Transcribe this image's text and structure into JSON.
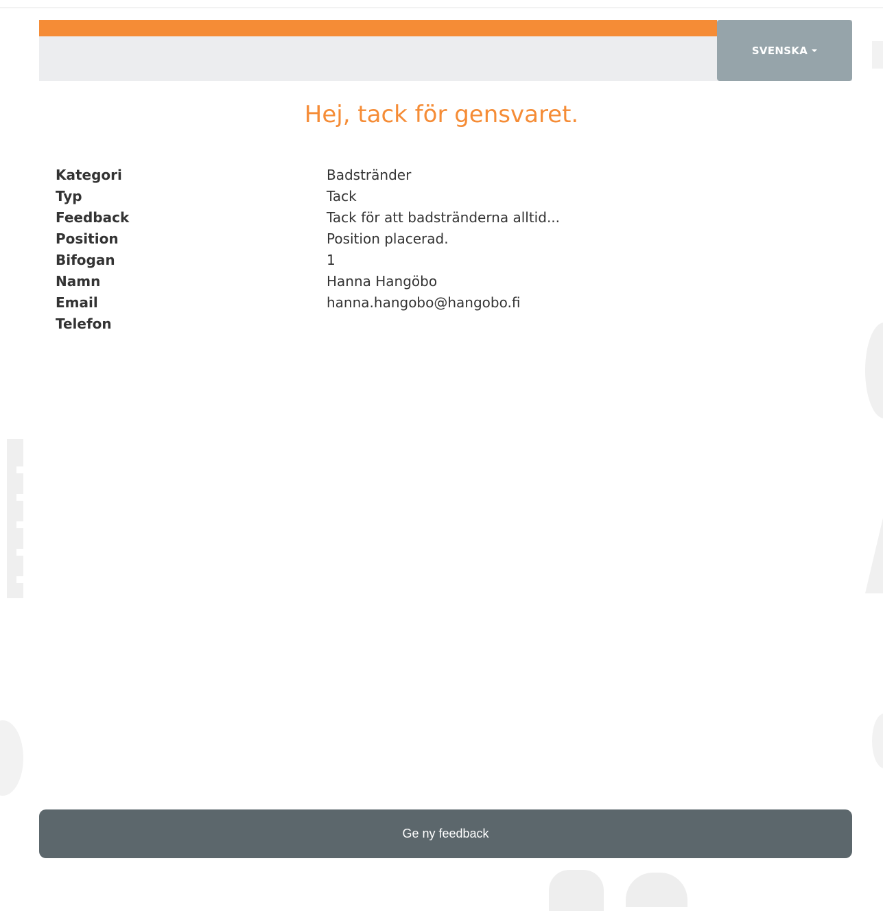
{
  "header": {
    "language_label": "SVENSKA",
    "accent_color": "#f58c36",
    "language_button_color": "#96a4aa"
  },
  "title": "Hej, tack för gensvaret.",
  "details": [
    {
      "label": "Kategori",
      "value": "Badstränder"
    },
    {
      "label": "Typ",
      "value": "Tack"
    },
    {
      "label": "Feedback",
      "value": "Tack för att badstränderna alltid..."
    },
    {
      "label": "Position",
      "value": "Position placerad."
    },
    {
      "label": "Bifogan",
      "value": "1"
    },
    {
      "label": "Namn",
      "value": "Hanna Hangöbo"
    },
    {
      "label": "Email",
      "value": "hanna.hangobo@hangobo.fi"
    },
    {
      "label": "Telefon",
      "value": ""
    }
  ],
  "footer": {
    "new_feedback_label": "Ge ny feedback",
    "button_color": "#5c676c"
  }
}
